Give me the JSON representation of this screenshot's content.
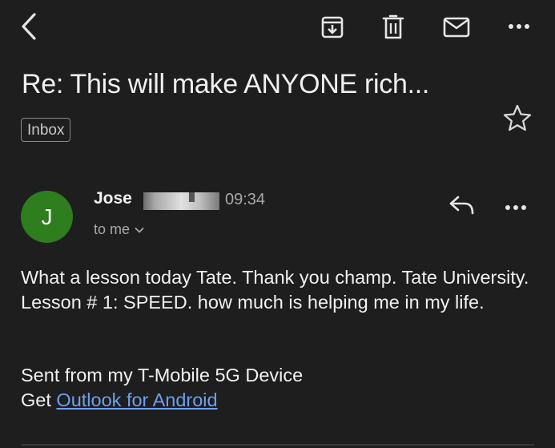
{
  "email": {
    "subject": "Re: This will make ANYONE rich...",
    "label": "Inbox",
    "sender": {
      "initial": "J",
      "name": "Jose",
      "time": "09:34",
      "recipient": "to me",
      "avatar_color": "#2e7d1f"
    },
    "body": "What a lesson today Tate. Thank you champ. Tate University. Lesson # 1: SPEED. how much is helping me in my life.",
    "signature": {
      "line1": "Sent from my T-Mobile 5G Device",
      "line2_prefix": "Get ",
      "link_text": "Outlook for Android"
    }
  },
  "toolbar": {
    "icons": [
      "back-arrow-icon",
      "archive-icon",
      "delete-icon",
      "mark-unread-icon",
      "more-options-icon"
    ]
  },
  "colors": {
    "background": "#1e1e1e",
    "text": "#f0f0f0",
    "muted": "#a8a8a8",
    "link": "#6ea0f0"
  }
}
